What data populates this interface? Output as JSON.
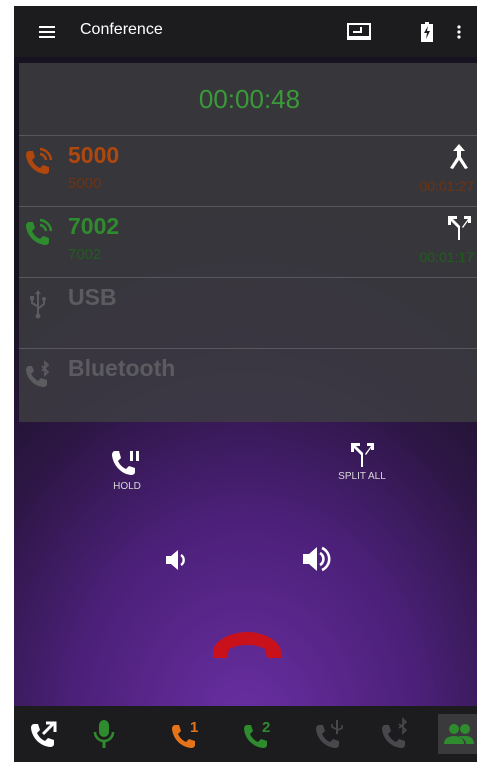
{
  "header": {
    "title": "Conference",
    "icons": [
      "menu-icon",
      "screen-icon",
      "battery-icon",
      "more-vert-icon"
    ]
  },
  "call_timer": "00:00:48",
  "calls": [
    {
      "name": "5000",
      "number": "5000",
      "duration": "00:01:27",
      "color": "#b0470d",
      "action_icon": "merge-icon"
    },
    {
      "name": "7002",
      "number": "7002",
      "duration": "00:01:17",
      "color": "#2e8b2e",
      "action_icon": "split-icon"
    },
    {
      "name": "USB",
      "number": "",
      "duration": "",
      "color": "#5c5c60",
      "action_icon": ""
    },
    {
      "name": "Bluetooth",
      "number": "",
      "duration": "",
      "color": "#5c5c60",
      "action_icon": ""
    }
  ],
  "controls": {
    "hold_label": "HOLD",
    "split_all_label": "SPLIT ALL"
  },
  "bottom_bar": {
    "line1_label": "1",
    "line2_label": "2",
    "icons": [
      "transfer-call-icon",
      "microphone-icon",
      "line-1-call-icon",
      "line-2-call-icon",
      "usb-call-icon",
      "bluetooth-call-icon",
      "conference-icon"
    ]
  },
  "colors": {
    "accent_green": "#2e8b2e",
    "accent_orange": "#b0470d",
    "orange_bright": "#e5731a",
    "hangup_red": "#c9111b",
    "disabled_gray": "#5c5c60"
  }
}
